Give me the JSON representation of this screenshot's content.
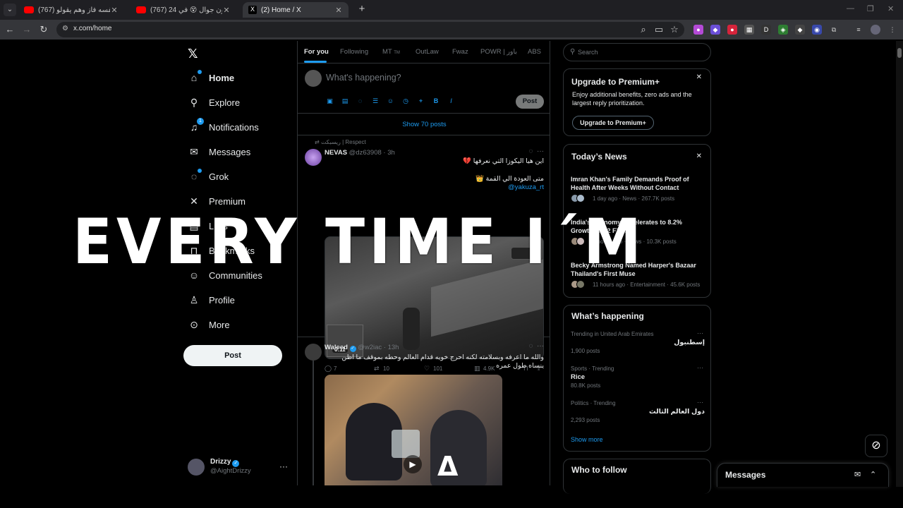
{
  "browser": {
    "tabs": [
      {
        "title": "(767) يحسب نفسه فاز وهم يقولو...",
        "favicon": "youtube"
      },
      {
        "title": "(767) 24 ساعه بدون جوال 😵 في...",
        "favicon": "youtube"
      },
      {
        "title": "(2) Home / X",
        "favicon": "x"
      }
    ],
    "new_tab": "+",
    "url": "x.com/home"
  },
  "nav": {
    "logo": "𝕏",
    "items": [
      {
        "label": "Home",
        "icon": "home-icon"
      },
      {
        "label": "Explore",
        "icon": "search-icon"
      },
      {
        "label": "Notifications",
        "icon": "bell-icon",
        "badge": "1"
      },
      {
        "label": "Messages",
        "icon": "mail-icon"
      },
      {
        "label": "Grok",
        "icon": "grok-icon"
      },
      {
        "label": "Premium",
        "icon": "x-icon"
      },
      {
        "label": "Lists",
        "icon": "list-icon"
      },
      {
        "label": "Bookmarks",
        "icon": "bookmark-icon"
      },
      {
        "label": "Communities",
        "icon": "people-icon"
      },
      {
        "label": "Profile",
        "icon": "person-icon"
      },
      {
        "label": "More",
        "icon": "more-icon"
      }
    ],
    "post_button": "Post",
    "account": {
      "name": "Drizzy",
      "handle": "@AightDrizzy"
    }
  },
  "main": {
    "tabs": [
      "For you",
      "Following",
      "MT",
      "OutLaw",
      "Fwaz",
      "POWR | باور",
      "ABS"
    ],
    "mt_suffix": "TM",
    "compose_placeholder": "What's happening?",
    "compose_post": "Post",
    "show_posts": "Show 70 posts",
    "tweet1": {
      "repost_context": "ريسبكت | Respect",
      "name": "NEVAS",
      "handle": "@dz63908",
      "time": "3h",
      "line1": "اين هيا اليكوزا التي نعرفها 💔",
      "line2": "متى العودة الي القمة 👑",
      "mention": "@yakuza_rt",
      "video_duration": "0:11",
      "replies": "7",
      "reposts": "10",
      "likes": "101",
      "views": "4.9K"
    },
    "tweet2": {
      "name": "Waleed",
      "handle": "@w2iac",
      "time": "13h",
      "text": "والله ما اعرفه وبسلامته لكنه احرج خويه قدام العالم وحطه بموقف ما اظن ينساه طول عمره"
    }
  },
  "right": {
    "search_placeholder": "Search",
    "premium": {
      "title": "Upgrade to Premium+",
      "desc": "Enjoy additional benefits, zero ads and the largest reply prioritization.",
      "button": "Upgrade to Premium+"
    },
    "news": {
      "title": "Today’s News",
      "items": [
        {
          "title": "Imran Khan's Family Demands Proof of Health After Weeks Without Contact",
          "meta": "1 day ago · News · 267.7K posts"
        },
        {
          "title": "India's Economy Accelerates to 8.2% Growth in Q2 FY26",
          "meta": "5 hours ago · News · 10.3K posts"
        },
        {
          "title": "Becky Armstrong Named Harper's Bazaar Thailand's First Muse",
          "meta": "11 hours ago · Entertainment · 45.6K posts"
        }
      ]
    },
    "happening": {
      "title": "What’s happening",
      "trends": [
        {
          "context": "Trending in United Arab Emirates",
          "name": "إسطنبول",
          "count": "1,900 posts"
        },
        {
          "context": "Sports · Trending",
          "name": "Rice",
          "count": "80.8K posts"
        },
        {
          "context": "Politics · Trending",
          "name": "دول العالم الثالث",
          "count": "2,293 posts"
        }
      ],
      "show_more": "Show more"
    },
    "who_to_follow": "Who to follow"
  },
  "messages_drawer": "Messages",
  "overlay_caption": "EVERY TIME I´M",
  "colors": {
    "accent": "#1d9bf0",
    "background": "#000000",
    "border": "#2f3336"
  }
}
